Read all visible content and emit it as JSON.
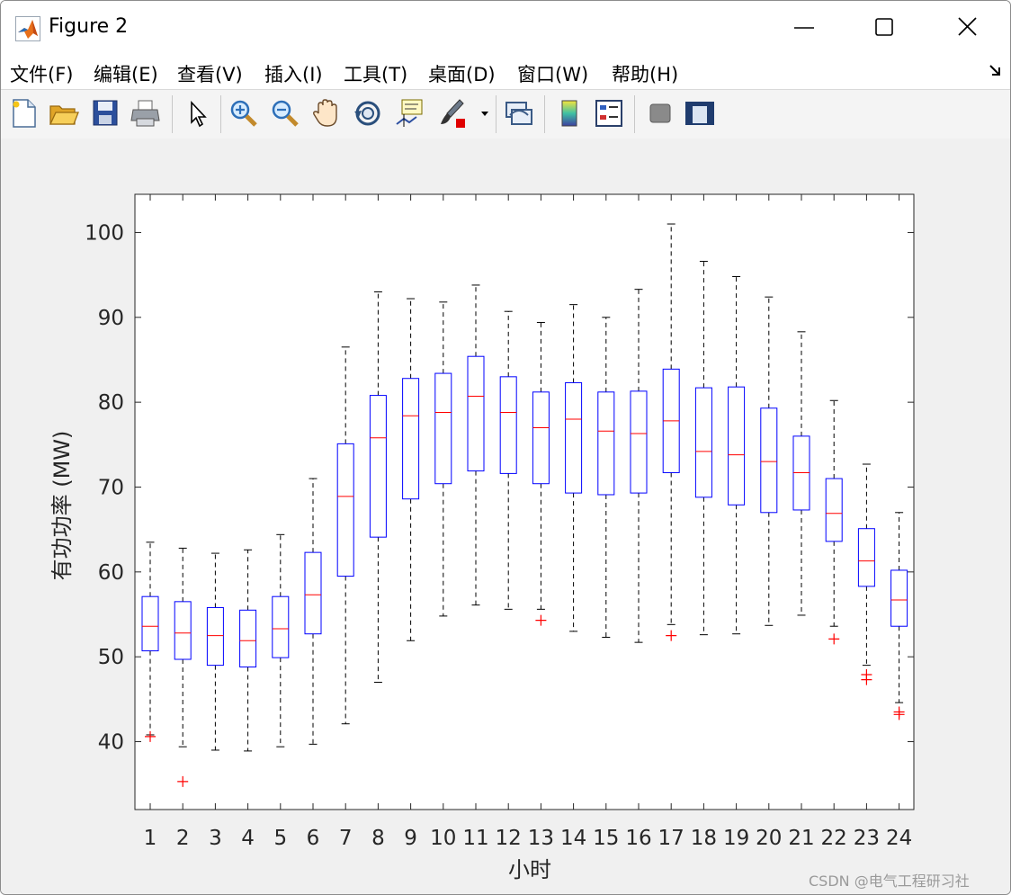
{
  "window": {
    "title": "Figure 2",
    "controls": [
      "minimize-icon",
      "maximize-icon",
      "close-icon"
    ]
  },
  "menu": {
    "items": [
      "文件(F)",
      "编辑(E)",
      "查看(V)",
      "插入(I)",
      "工具(T)",
      "桌面(D)",
      "窗口(W)",
      "帮助(H)"
    ]
  },
  "toolbar": {
    "icons": [
      "new-figure-icon",
      "open-file-icon",
      "save-icon",
      "print-icon",
      "edit-plot-arrow-icon",
      "zoom-in-icon",
      "zoom-out-icon",
      "pan-hand-icon",
      "rotate-3d-icon",
      "data-cursor-icon",
      "brush-icon",
      "brush-dropdown-icon",
      "link-plot-icon",
      "colorbar-icon",
      "legend-icon",
      "hide-plot-tools-icon",
      "show-plot-tools-icon"
    ]
  },
  "chart_data": {
    "type": "boxplot",
    "title": "",
    "xlabel": "小时",
    "ylabel": "有功功率 (MW)",
    "ylim": [
      32,
      104.5
    ],
    "yticks": [
      40,
      50,
      60,
      70,
      80,
      90,
      100
    ],
    "categories": [
      "1",
      "2",
      "3",
      "4",
      "5",
      "6",
      "7",
      "8",
      "9",
      "10",
      "11",
      "12",
      "13",
      "14",
      "15",
      "16",
      "17",
      "18",
      "19",
      "20",
      "21",
      "22",
      "23",
      "24"
    ],
    "colors": {
      "box": "#0000ff",
      "median": "#ff0000",
      "whisker": "#000000",
      "outlier": "#ff0000"
    },
    "series": [
      {
        "q1": 50.7,
        "median": 53.6,
        "q3": 57.1,
        "low": 40.8,
        "high": 63.5,
        "outliers": [
          40.6
        ]
      },
      {
        "q1": 49.7,
        "median": 52.8,
        "q3": 56.5,
        "low": 39.4,
        "high": 62.8,
        "outliers": [
          35.3
        ]
      },
      {
        "q1": 49.0,
        "median": 52.5,
        "q3": 55.8,
        "low": 39.0,
        "high": 62.2,
        "outliers": []
      },
      {
        "q1": 48.8,
        "median": 51.9,
        "q3": 55.5,
        "low": 38.9,
        "high": 62.6,
        "outliers": []
      },
      {
        "q1": 49.9,
        "median": 53.3,
        "q3": 57.1,
        "low": 39.4,
        "high": 64.4,
        "outliers": []
      },
      {
        "q1": 52.7,
        "median": 57.3,
        "q3": 62.3,
        "low": 39.7,
        "high": 71.0,
        "outliers": []
      },
      {
        "q1": 59.5,
        "median": 68.9,
        "q3": 75.1,
        "low": 42.1,
        "high": 86.5,
        "outliers": []
      },
      {
        "q1": 64.1,
        "median": 75.8,
        "q3": 80.8,
        "low": 47.0,
        "high": 93.0,
        "outliers": []
      },
      {
        "q1": 68.6,
        "median": 78.4,
        "q3": 82.8,
        "low": 51.9,
        "high": 92.2,
        "outliers": []
      },
      {
        "q1": 70.4,
        "median": 78.8,
        "q3": 83.4,
        "low": 54.8,
        "high": 91.8,
        "outliers": []
      },
      {
        "q1": 71.9,
        "median": 80.7,
        "q3": 85.4,
        "low": 56.1,
        "high": 93.8,
        "outliers": []
      },
      {
        "q1": 71.6,
        "median": 78.8,
        "q3": 83.0,
        "low": 55.6,
        "high": 90.7,
        "outliers": []
      },
      {
        "q1": 70.4,
        "median": 77.0,
        "q3": 81.2,
        "low": 55.6,
        "high": 89.4,
        "outliers": [
          54.3
        ]
      },
      {
        "q1": 69.3,
        "median": 78.0,
        "q3": 82.3,
        "low": 53.0,
        "high": 91.5,
        "outliers": []
      },
      {
        "q1": 69.1,
        "median": 76.6,
        "q3": 81.2,
        "low": 52.3,
        "high": 90.0,
        "outliers": []
      },
      {
        "q1": 69.3,
        "median": 76.3,
        "q3": 81.3,
        "low": 51.7,
        "high": 93.3,
        "outliers": []
      },
      {
        "q1": 71.7,
        "median": 77.8,
        "q3": 83.9,
        "low": 53.8,
        "high": 101.0,
        "outliers": [
          52.5
        ]
      },
      {
        "q1": 68.8,
        "median": 74.2,
        "q3": 81.7,
        "low": 52.6,
        "high": 96.6,
        "outliers": []
      },
      {
        "q1": 67.9,
        "median": 73.8,
        "q3": 81.8,
        "low": 52.7,
        "high": 94.8,
        "outliers": []
      },
      {
        "q1": 67.0,
        "median": 73.0,
        "q3": 79.3,
        "low": 53.7,
        "high": 92.4,
        "outliers": []
      },
      {
        "q1": 67.3,
        "median": 71.7,
        "q3": 76.0,
        "low": 54.9,
        "high": 88.3,
        "outliers": []
      },
      {
        "q1": 63.6,
        "median": 66.9,
        "q3": 71.0,
        "low": 53.6,
        "high": 80.2,
        "outliers": [
          52.1
        ]
      },
      {
        "q1": 58.3,
        "median": 61.3,
        "q3": 65.1,
        "low": 49.0,
        "high": 72.7,
        "outliers": [
          47.9,
          47.3
        ]
      },
      {
        "q1": 53.6,
        "median": 56.7,
        "q3": 60.2,
        "low": 44.6,
        "high": 67.0,
        "outliers": [
          43.5,
          43.2
        ]
      }
    ]
  },
  "watermark": "CSDN @电气工程研习社"
}
